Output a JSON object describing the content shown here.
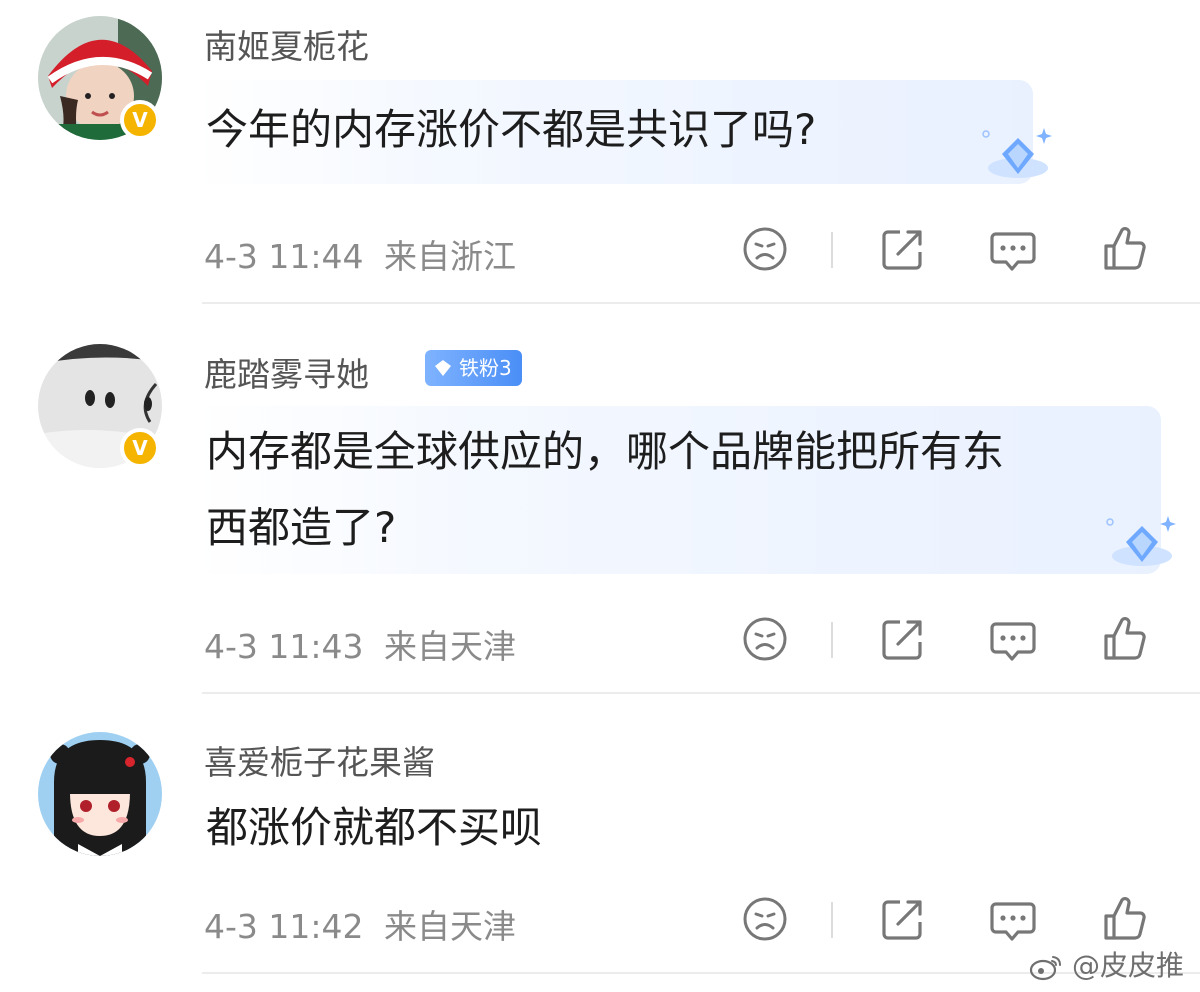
{
  "comments": [
    {
      "username": "南姬夏栀花",
      "text": "今年的内存涨价不都是共识了吗?",
      "text_lines": [
        "今年的内存涨价不都是共识了吗?"
      ],
      "timestamp": "4-3 11:44",
      "location": "来自浙江",
      "verified": true,
      "badge": null
    },
    {
      "username": "鹿踏雾寻她",
      "text_lines": [
        "内存都是全球供应的，哪个品牌能把所有东",
        "西都造了?"
      ],
      "timestamp": "4-3 11:43",
      "location": "来自天津",
      "verified": true,
      "badge": "铁粉3"
    },
    {
      "username": "喜爱栀子花果酱",
      "text_lines": [
        "都涨价就都不买呗"
      ],
      "timestamp": "4-3 11:42",
      "location": "来自天津",
      "verified": false,
      "badge": null
    }
  ],
  "verified_mark": "V",
  "watermark": "@皮皮推",
  "colors": {
    "verified": "#f5b400",
    "fan_badge": "#4a8ef6",
    "text": "#1d1d1d",
    "meta": "#8a8a8a",
    "icon": "#777777"
  },
  "icons": [
    "dislike-icon",
    "share-icon",
    "reply-icon",
    "like-icon",
    "weibo-logo-icon",
    "diamond-icon"
  ]
}
